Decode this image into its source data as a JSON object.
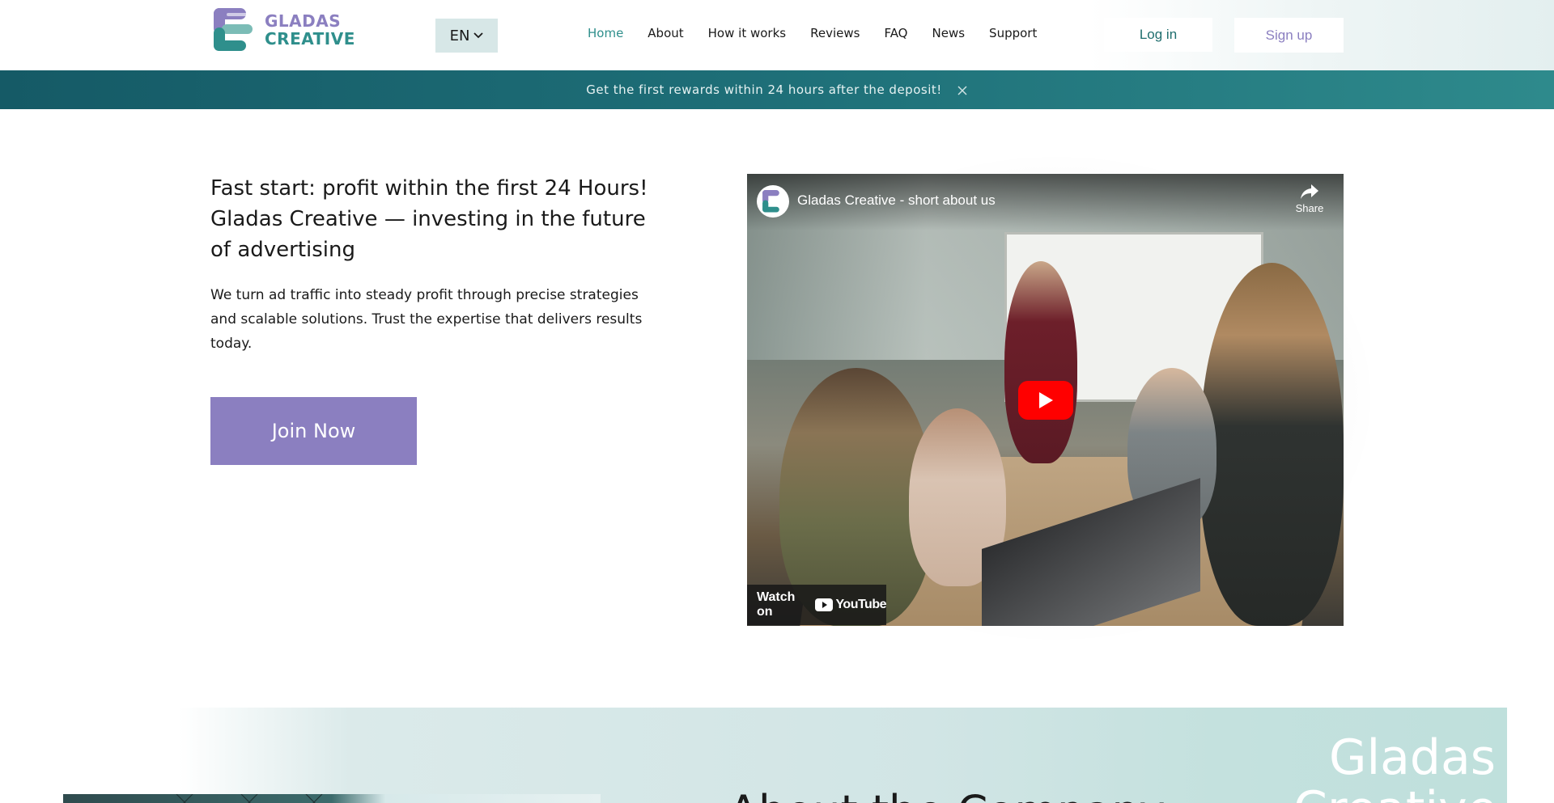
{
  "brand": {
    "line1": "GLADAS",
    "line2": "CREATIVE",
    "colors": {
      "purple": "#8b7fc0",
      "teal": "#2f8f8c"
    }
  },
  "header": {
    "language": "EN",
    "nav": [
      {
        "label": "Home",
        "active": true
      },
      {
        "label": "About",
        "active": false
      },
      {
        "label": "How it works",
        "active": false
      },
      {
        "label": "Reviews",
        "active": false
      },
      {
        "label": "FAQ",
        "active": false
      },
      {
        "label": "News",
        "active": false
      },
      {
        "label": "Support",
        "active": false
      }
    ],
    "login_label": "Log in",
    "signup_label": "Sign up"
  },
  "banner": {
    "text": "Get the first rewards within 24 hours after the deposit!",
    "close_icon": "close-icon"
  },
  "hero": {
    "title": "Fast start: profit within the first 24 Hours! Gladas Creative — investing in the future of advertising",
    "description": "We turn ad traffic into steady profit through precise strategies and scalable solutions. Trust the expertise that delivers results today.",
    "cta_label": "Join Now"
  },
  "video": {
    "title": "Gladas Creative - short about us",
    "share_label": "Share",
    "watch_on_label": "Watch on",
    "youtube_label": "YouTube"
  },
  "about": {
    "heading": "About the Company",
    "brand_text": "Gladas Creative"
  }
}
